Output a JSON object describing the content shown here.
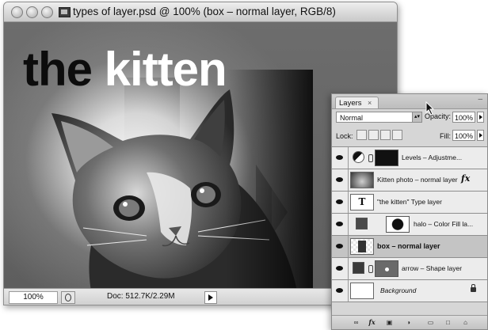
{
  "document_window": {
    "title": "types of layer.psd @ 100% (box – normal layer, RGB/8)",
    "type_layer_words": [
      "the",
      "kitten"
    ],
    "status": {
      "zoom": "100%",
      "doc_info": "Doc: 512.7K/2.29M"
    }
  },
  "layers_panel": {
    "tab_label": "Layers",
    "tab_close": "×",
    "collapse_glyph": "–",
    "blend_mode": "Normal",
    "opacity_label": "Opacity:",
    "opacity_value": "100%",
    "lock_label": "Lock:",
    "fill_label": "Fill:",
    "fill_value": "100%",
    "layers": [
      {
        "name": "Levels – Adjustme...",
        "thumb": "levels-adjustment-icon",
        "mask": "white-mask"
      },
      {
        "name": "Kitten photo – normal layer",
        "thumb": "kitten-thumbnail",
        "fx": "fx"
      },
      {
        "name": "\"the kitten\" Type layer",
        "thumb": "T"
      },
      {
        "name": "halo – Color Fill la...",
        "thumb": "color-fill",
        "mask": "halo-mask"
      },
      {
        "name": "box – normal layer",
        "thumb": "box-thumbnail",
        "selected": true
      },
      {
        "name": "arrow – Shape layer",
        "thumb": "shape-fill",
        "mask": "arrow-vector-mask"
      },
      {
        "name": "Background",
        "thumb": "white",
        "locked": true
      }
    ],
    "bottom_icons": [
      "link-layers-icon",
      "fx",
      "add-mask-icon",
      "adjustment-layer-icon",
      "new-group-icon",
      "new-layer-icon",
      "trash-icon"
    ]
  },
  "colors": {
    "canvas_bg": "#666666",
    "panel_bg": "#d6d6d6",
    "selected_row": "#c4c4c4"
  }
}
